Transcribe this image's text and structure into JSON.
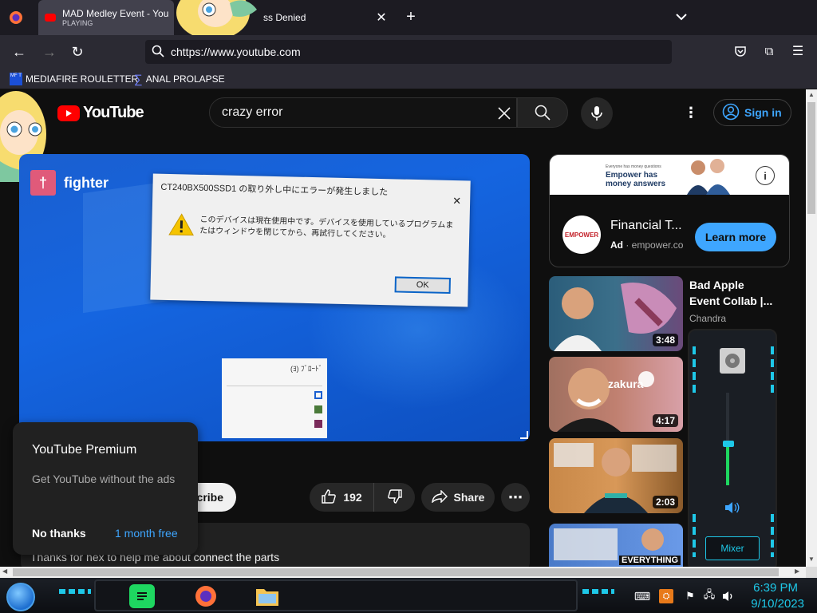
{
  "browser": {
    "tabs": [
      {
        "title": "MAD Medley Event - You",
        "subtitle": "PLAYING"
      },
      {
        "title": "ss Denied"
      }
    ],
    "url": "chttps://www.youtube.com",
    "bookmarks": [
      "MEDIAFIRE ROULETTER",
      "ANAL PROLAPSE"
    ],
    "bookmark_icon_text": "MF T"
  },
  "youtube": {
    "logo": "YouTube",
    "search_value": "crazy error",
    "sign_in": "Sign in",
    "video": {
      "overlay_channel": "fighter",
      "dialog_title": "CT240BX500SSD1 の取り外し中にエラーが発生しました",
      "dialog_message": "このデバイスは現在使用中です。デバイスを使用しているプログラムまたはウィンドウを閉じてから、再試行してください。",
      "dialog_ok": "OK",
      "small_window_title": "(ﾖ) ﾌﾞﾛｰﾄﾞ"
    },
    "actions": {
      "subscribe": "cribe",
      "likes": "192",
      "share": "Share"
    },
    "premium_popup": {
      "title": "YouTube Premium",
      "desc": "Get YouTube without the ads",
      "no_thanks": "No thanks",
      "trial": "1 month free"
    },
    "comment": "Thanks for hex to help me about connect the parts",
    "ad": {
      "banner_line1": "Everyone has money questions",
      "banner_line2": "Empower has",
      "banner_line3": "money answers",
      "logo_text": "EMPOWER",
      "title": "Financial T...",
      "badge": "Ad",
      "domain": "empower.co",
      "cta": "Learn more"
    },
    "related": [
      {
        "title_line1": "Bad Apple",
        "title_line2": "Event Collab |...",
        "channel": "Chandra",
        "duration": "3:48"
      },
      {
        "duration": "4:17",
        "overlay": "zakura"
      },
      {
        "duration": "2:03"
      },
      {
        "overlay": "EVERYTHING"
      }
    ]
  },
  "mixer": {
    "label": "Mixer",
    "volume": 0.45
  },
  "taskbar": {
    "time": "6:39 PM",
    "date": "9/10/2023"
  },
  "colors": {
    "accent": "#3ea6ff",
    "yt_red": "#ff0000",
    "cyan": "#1ec8e8",
    "spotify": "#1ed760"
  }
}
